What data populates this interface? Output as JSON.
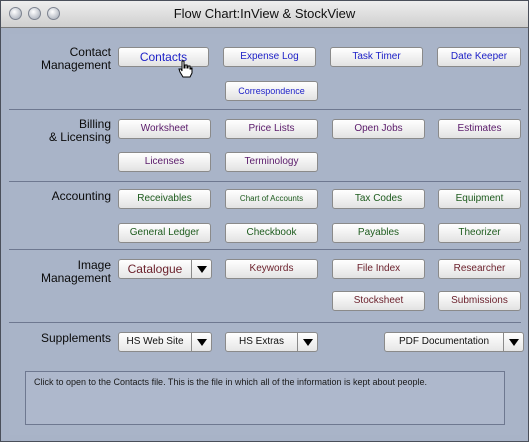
{
  "window": {
    "title": "Flow Chart:InView & StockView"
  },
  "sections": {
    "contact": {
      "label_line1": "Contact",
      "label_line2": "Management",
      "buttons": [
        "Contacts",
        "Expense Log",
        "Task Timer",
        "Date Keeper",
        "Correspondence"
      ]
    },
    "billing": {
      "label_line1": "Billing",
      "label_line2": "& Licensing",
      "buttons": [
        "Worksheet",
        "Price Lists",
        "Open Jobs",
        "Estimates",
        "Licenses",
        "Terminology"
      ]
    },
    "accounting": {
      "label": "Accounting",
      "buttons": [
        "Receivables",
        "Chart of Accounts",
        "Tax Codes",
        "Equipment",
        "General Ledger",
        "Checkbook",
        "Payables",
        "Theorizer"
      ]
    },
    "image": {
      "label_line1": "Image",
      "label_line2": "Management",
      "dropdown": "Catalogue",
      "buttons": [
        "Keywords",
        "File Index",
        "Researcher",
        "Stocksheet",
        "Submissions"
      ]
    },
    "supplements": {
      "label": "Supplements",
      "dropdowns": [
        "HS Web Site",
        "HS Extras",
        "PDF Documentation"
      ]
    }
  },
  "message": "Click to open to the Contacts file. This is the file in which all of the information is kept about people.",
  "icons": [
    "close-dot",
    "minimize-dot",
    "zoom-dot",
    "dropdown-arrow-icon",
    "hand-cursor-icon"
  ],
  "colors": {
    "background": "#a8b3c7",
    "contact_text": "#1f22c8",
    "billing_text": "#5a1a6a",
    "accounting_text": "#1d5b1d",
    "image_text": "#6a1f2a"
  }
}
